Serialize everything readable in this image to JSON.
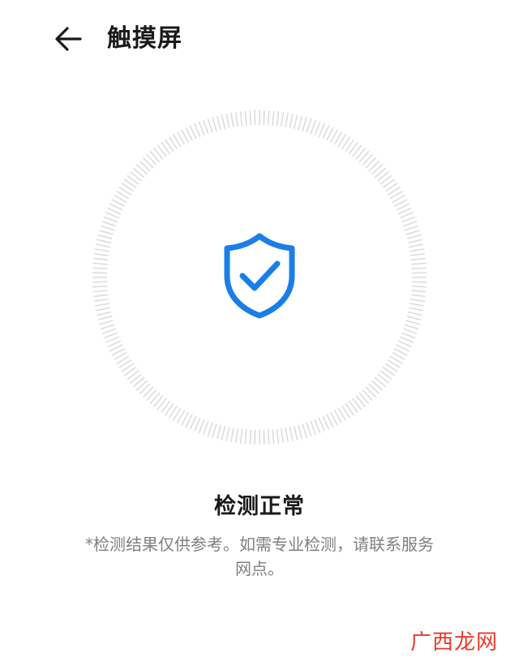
{
  "header": {
    "back_icon": "arrow-left-icon",
    "title": "触摸屏"
  },
  "result": {
    "icon": "shield-check-icon",
    "icon_color": "#1a7ee8",
    "ring_color": "#dcdcdc",
    "status": "检测正常",
    "note_line1": "*检测结果仅供参考。如需专业检测，请联系服务",
    "note_line2": "网点。"
  },
  "watermark": {
    "text": "广西龙网",
    "color": "#e8392b"
  }
}
